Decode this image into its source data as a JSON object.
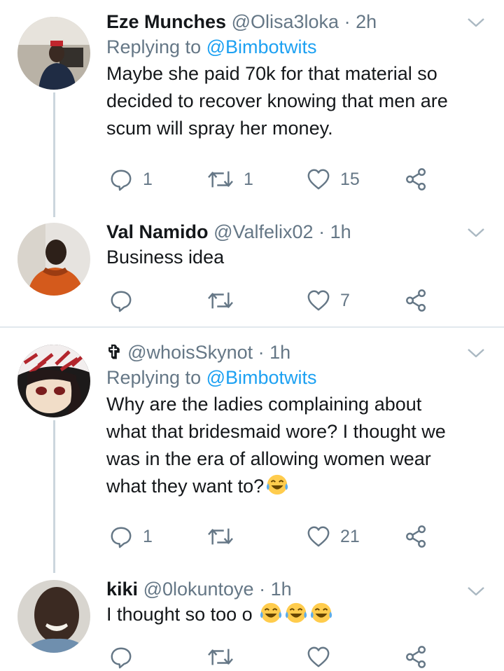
{
  "tweets": [
    {
      "name": "Eze Munches",
      "handle": "@Olisa3loka",
      "time": "2h",
      "replying_prefix": "Replying to",
      "replying_to": "@Bimbotwits",
      "lines": [
        "Maybe she paid 70k for that material so",
        "decided to recover knowing that men are",
        "scum will spray her money."
      ],
      "replies": "1",
      "retweets": "1",
      "likes": "15"
    },
    {
      "name": "Val Namido",
      "handle": "@Valfelix02",
      "time": "1h",
      "lines": [
        "Business idea"
      ],
      "replies": "",
      "retweets": "",
      "likes": "7"
    },
    {
      "name": "✞",
      "handle": "@whoisSkynot",
      "time": "1h",
      "replying_prefix": "Replying to",
      "replying_to": "@Bimbotwits",
      "lines": [
        "Why are the ladies complaining about",
        "what that bridesmaid wore? I thought we",
        "was in the era of allowing women wear",
        "what they want to?"
      ],
      "replies": "1",
      "retweets": "",
      "likes": "21"
    },
    {
      "name": "kiki",
      "handle": "@0lokuntoye",
      "time": "1h",
      "lines": [
        "I thought so too o"
      ]
    }
  ],
  "separator": "·",
  "icons": {
    "reply": "reply-icon",
    "retweet": "retweet-icon",
    "like": "heart-icon",
    "share": "share-icon",
    "menu": "chevron-down-icon",
    "emoji": "laughing-tears-emoji"
  },
  "colors": {
    "accent": "#1da1f2",
    "muted": "#657786",
    "thread": "#ccd6dd",
    "divider": "#e1e8ed"
  }
}
